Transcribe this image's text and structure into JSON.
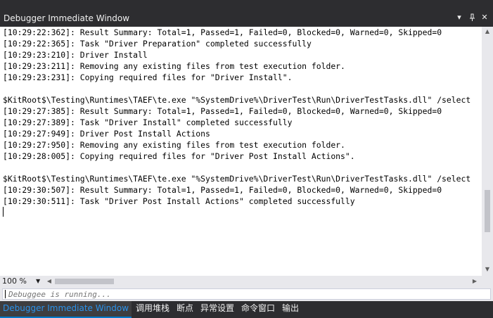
{
  "window": {
    "title": "Debugger Immediate Window",
    "controls": {
      "dropdown": "▾",
      "pin": "⊣",
      "close": "✕"
    }
  },
  "output": {
    "lines": [
      "[10:29:22:362]: Result Summary: Total=1, Passed=1, Failed=0, Blocked=0, Warned=0, Skipped=0",
      "[10:29:22:365]: Task \"Driver Preparation\" completed successfully",
      "[10:29:23:210]: Driver Install",
      "[10:29:23:211]: Removing any existing files from test execution folder.",
      "[10:29:23:231]: Copying required files for \"Driver Install\".",
      "",
      "$KitRoot$\\Testing\\Runtimes\\TAEF\\te.exe \"%SystemDrive%\\DriverTest\\Run\\DriverTestTasks.dll\" /select",
      "[10:29:27:385]: Result Summary: Total=1, Passed=1, Failed=0, Blocked=0, Warned=0, Skipped=0",
      "[10:29:27:389]: Task \"Driver Install\" completed successfully",
      "[10:29:27:949]: Driver Post Install Actions",
      "[10:29:27:950]: Removing any existing files from test execution folder.",
      "[10:29:28:005]: Copying required files for \"Driver Post Install Actions\".",
      "",
      "$KitRoot$\\Testing\\Runtimes\\TAEF\\te.exe \"%SystemDrive%\\DriverTest\\Run\\DriverTestTasks.dll\" /select",
      "[10:29:30:507]: Result Summary: Total=1, Passed=1, Failed=0, Blocked=0, Warned=0, Skipped=0",
      "[10:29:30:511]: Task \"Driver Post Install Actions\" completed successfully"
    ]
  },
  "zoom": {
    "level": "100 %"
  },
  "input": {
    "placeholder": "Debuggee is running..."
  },
  "tabs": [
    {
      "label": "Debugger Immediate Window",
      "active": true
    },
    {
      "label": "调用堆栈",
      "active": false
    },
    {
      "label": "断点",
      "active": false
    },
    {
      "label": "异常设置",
      "active": false
    },
    {
      "label": "命令窗口",
      "active": false
    },
    {
      "label": "输出",
      "active": false
    }
  ],
  "colors": {
    "chrome": "#2d2d30",
    "active_tab_text": "#2b92ea",
    "accent": "#007acc",
    "output_bg": "#ffffff"
  }
}
